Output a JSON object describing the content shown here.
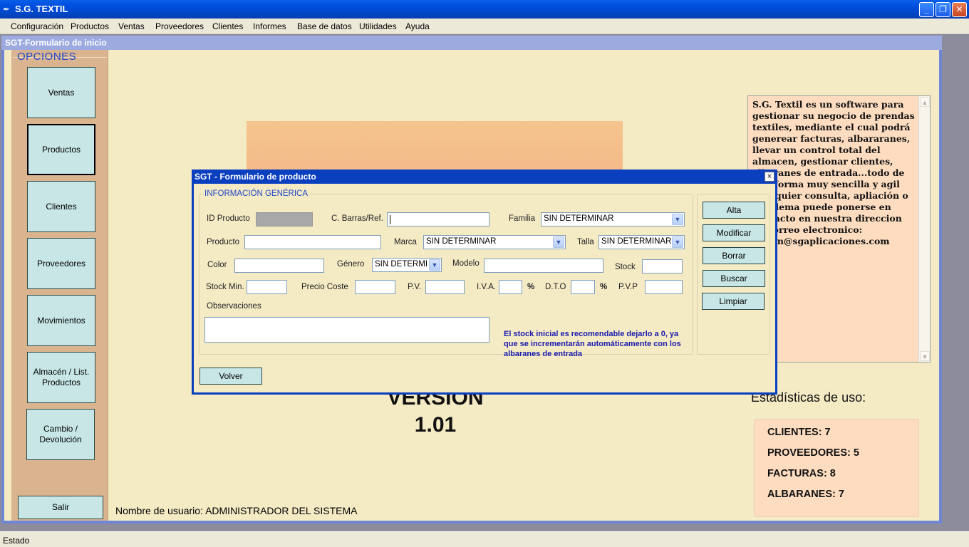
{
  "window": {
    "title": "S.G. TEXTIL"
  },
  "menu": [
    "Configuración",
    "Productos",
    "Ventas",
    "Proveedores",
    "Clientes",
    "Informes",
    "Base de datos",
    "Utilidades",
    "Ayuda"
  ],
  "inicio": {
    "title": "SGT-Formulario de inicio",
    "options_title": "OPCIONES",
    "buttons": [
      "Ventas",
      "Productos",
      "Clientes",
      "Proveedores",
      "Movimientos",
      "Almacén / List. Productos",
      "Cambio / Devolución"
    ],
    "exit": "Salir",
    "version_line1": "VERSION",
    "version_line2": "1.01",
    "username": "Nombre de usuario: ADMINISTRADOR DEL SISTEMA",
    "description": "S.G. Textil es un software para gestionar su negocio de prendas textiles, mediante el cual podrá generear facturas, albararanes, llevar un control total del almacen, gestionar clientes, albaranes de entrada...todo de una forma muy sencilla y agil Cualquier consulta, apliación o problema puede ponerse en contacto en nuestra direccion de correo electronico: admin@sgaplicaciones.com",
    "stats_title": "Estadísticas de uso:",
    "stats": [
      "CLIENTES: 7",
      "PROVEEDORES: 5",
      "FACTURAS: 8",
      "ALBARANES: 7"
    ]
  },
  "dialog": {
    "title": "SGT - Formulario de producto",
    "close": "×",
    "legend": "INFORMACIÓN GENÉRICA",
    "labels": {
      "id": "ID Producto",
      "barcode": "C. Barras/Ref.",
      "familia": "Familia",
      "producto": "Producto",
      "marca": "Marca",
      "talla": "Talla",
      "color": "Color",
      "genero": "Género",
      "modelo": "Modelo",
      "stock": "Stock",
      "stock_min": "Stock Min.",
      "precio_coste": "Precio Coste",
      "pv": "P.V.",
      "iva": "I.V.A.",
      "pct1": "%",
      "dto": "D.T.O",
      "pct2": "%",
      "pvp": "P.V.P",
      "observaciones": "Observaciones"
    },
    "selects": {
      "familia": "SIN DETERMINAR",
      "marca": "SIN DETERMINAR",
      "talla": "SIN DETERMINAR",
      "genero": "SIN DETERMI"
    },
    "note": "El stock inicial es recomendable dejarlo a 0, ya que se incrementarán automáticamente con los albaranes de entrada",
    "actions": [
      "Alta",
      "Modificar",
      "Borrar",
      "Buscar",
      "Limpiar"
    ],
    "back": "Volver"
  },
  "status": "Estado"
}
